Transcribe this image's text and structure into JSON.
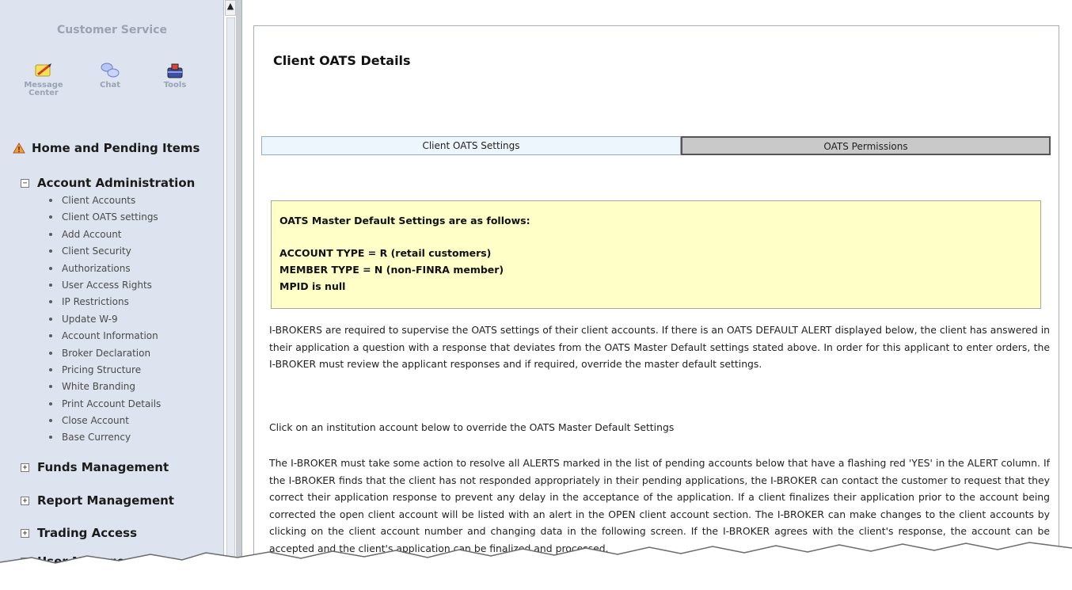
{
  "sidebar": {
    "title": "Customer Service",
    "tools": [
      {
        "label": "Message Center",
        "icon": "message-center-icon"
      },
      {
        "label": "Chat",
        "icon": "chat-icon"
      },
      {
        "label": "Tools",
        "icon": "tools-icon"
      }
    ],
    "home": {
      "label": "Home and Pending Items",
      "icon": "warning-icon"
    },
    "sections": [
      {
        "label": "Account Administration",
        "toggle": "−"
      },
      {
        "label": "Funds Management",
        "toggle": "+"
      },
      {
        "label": "Report Management",
        "toggle": "+"
      },
      {
        "label": "Trading Access",
        "toggle": "+"
      },
      {
        "label": "User Management",
        "toggle": "+"
      }
    ],
    "account_admin_items": [
      "Client Accounts",
      "Client OATS settings",
      "Add Account",
      "Client Security",
      "Authorizations",
      "User Access Rights",
      "IP Restrictions",
      "Update W-9",
      "Account Information",
      "Broker Declaration",
      "Pricing Structure",
      "White Branding",
      "Print Account Details",
      "Close Account",
      "Base Currency"
    ]
  },
  "main": {
    "title": "Client OATS Details",
    "tabs": [
      "Client OATS Settings",
      "OATS Permissions"
    ],
    "notice": {
      "heading": "OATS Master Default Settings are as follows:",
      "lines": [
        "ACCOUNT TYPE = R (retail customers)",
        "MEMBER TYPE = N (non-FINRA member)",
        "MPID is null"
      ]
    },
    "paragraphs": [
      "I-BROKERS are required to supervise the OATS settings of their client accounts. If there is an OATS DEFAULT ALERT displayed below, the client has answered in their application a question with a response that deviates from the OATS Master Default settings stated above. In order for this applicant to enter orders, the I-BROKER must review the applicant responses and if required, override the master default settings.",
      "Click on an institution account below to override the OATS Master Default Settings",
      "The I-BROKER must take some action to resolve all ALERTS marked in the list of pending accounts below that have a flashing red 'YES' in the ALERT column. If the I-BROKER finds that the client has not responded appropriately in their pending applications, the I-BROKER can contact the customer to request that they correct their application response to prevent any delay in the acceptance of the application. If a client finalizes their application prior to the account being corrected the open client account will be listed with an alert in the OPEN client account section. The I-BROKER can make changes to the client accounts by clicking on the client account number and changing data in the following screen. If the I-BROKER agrees with the client's response, the account can be accepted and the client's application can be finalized and processed."
    ]
  },
  "colors": {
    "sidebar_bg": "#dde4ef",
    "notice_bg": "#ffffc8",
    "active_tab_bg": "#eef6fd",
    "inactive_tab_bg": "#c9c9c9"
  }
}
